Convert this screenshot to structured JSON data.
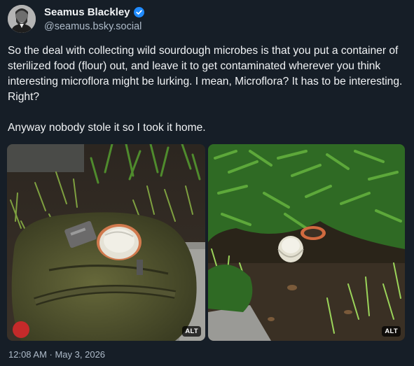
{
  "author": {
    "display_name": "Seamus Blackley",
    "handle": "@seamus.bsky.social",
    "verified": true
  },
  "post": {
    "paragraph1": "So the deal with collecting wild sourdough microbes is that you put a container of sterilized food (flour) out, and leave it to get contaminated wherever you think interesting microflora might be lurking. I mean, Microflora? It has to be interesting. Right?",
    "paragraph2": "Anyway nobody stole it so I took it home."
  },
  "images": [
    {
      "alt_badge": "ALT",
      "subject": "jar-on-backpack"
    },
    {
      "alt_badge": "ALT",
      "subject": "jar-under-shrub"
    }
  ],
  "timestamp": "12:08 AM · May 3, 2026",
  "colors": {
    "background": "#161e27",
    "verified_badge": "#208bfe",
    "secondary_text": "#aebbc9"
  }
}
